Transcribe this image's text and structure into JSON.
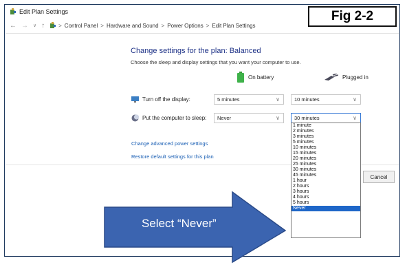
{
  "window": {
    "title": "Edit Plan Settings"
  },
  "figure_label": "Fig 2-2",
  "breadcrumb": {
    "items": [
      "Control Panel",
      "Hardware and Sound",
      "Power Options",
      "Edit Plan Settings"
    ],
    "separator": ">"
  },
  "main": {
    "heading": "Change settings for the plan: Balanced",
    "subheading": "Choose the sleep and display settings that you want your computer to use.",
    "columns": {
      "battery": "On battery",
      "plugged": "Plugged in"
    },
    "rows": {
      "display": {
        "label": "Turn off the display:",
        "battery_value": "5 minutes",
        "plugged_value": "10 minutes"
      },
      "sleep": {
        "label": "Put the computer to sleep:",
        "battery_value": "Never",
        "plugged_value": "30 minutes"
      }
    },
    "links": {
      "advanced": "Change advanced power settings",
      "restore": "Restore default settings for this plan"
    }
  },
  "dropdown": {
    "options": [
      "1 minute",
      "2 minutes",
      "3 minutes",
      "5 minutes",
      "10 minutes",
      "15 minutes",
      "20 minutes",
      "25 minutes",
      "30 minutes",
      "45 minutes",
      "1 hour",
      "2 hours",
      "3 hours",
      "4 hours",
      "5 hours",
      "Never"
    ],
    "highlighted": "Never"
  },
  "buttons": {
    "cancel": "Cancel"
  },
  "callout": {
    "text": "Select “Never”"
  },
  "colors": {
    "accent": "#1e66c8",
    "heading": "#1e3287",
    "callout_fill": "#3b64b0"
  }
}
